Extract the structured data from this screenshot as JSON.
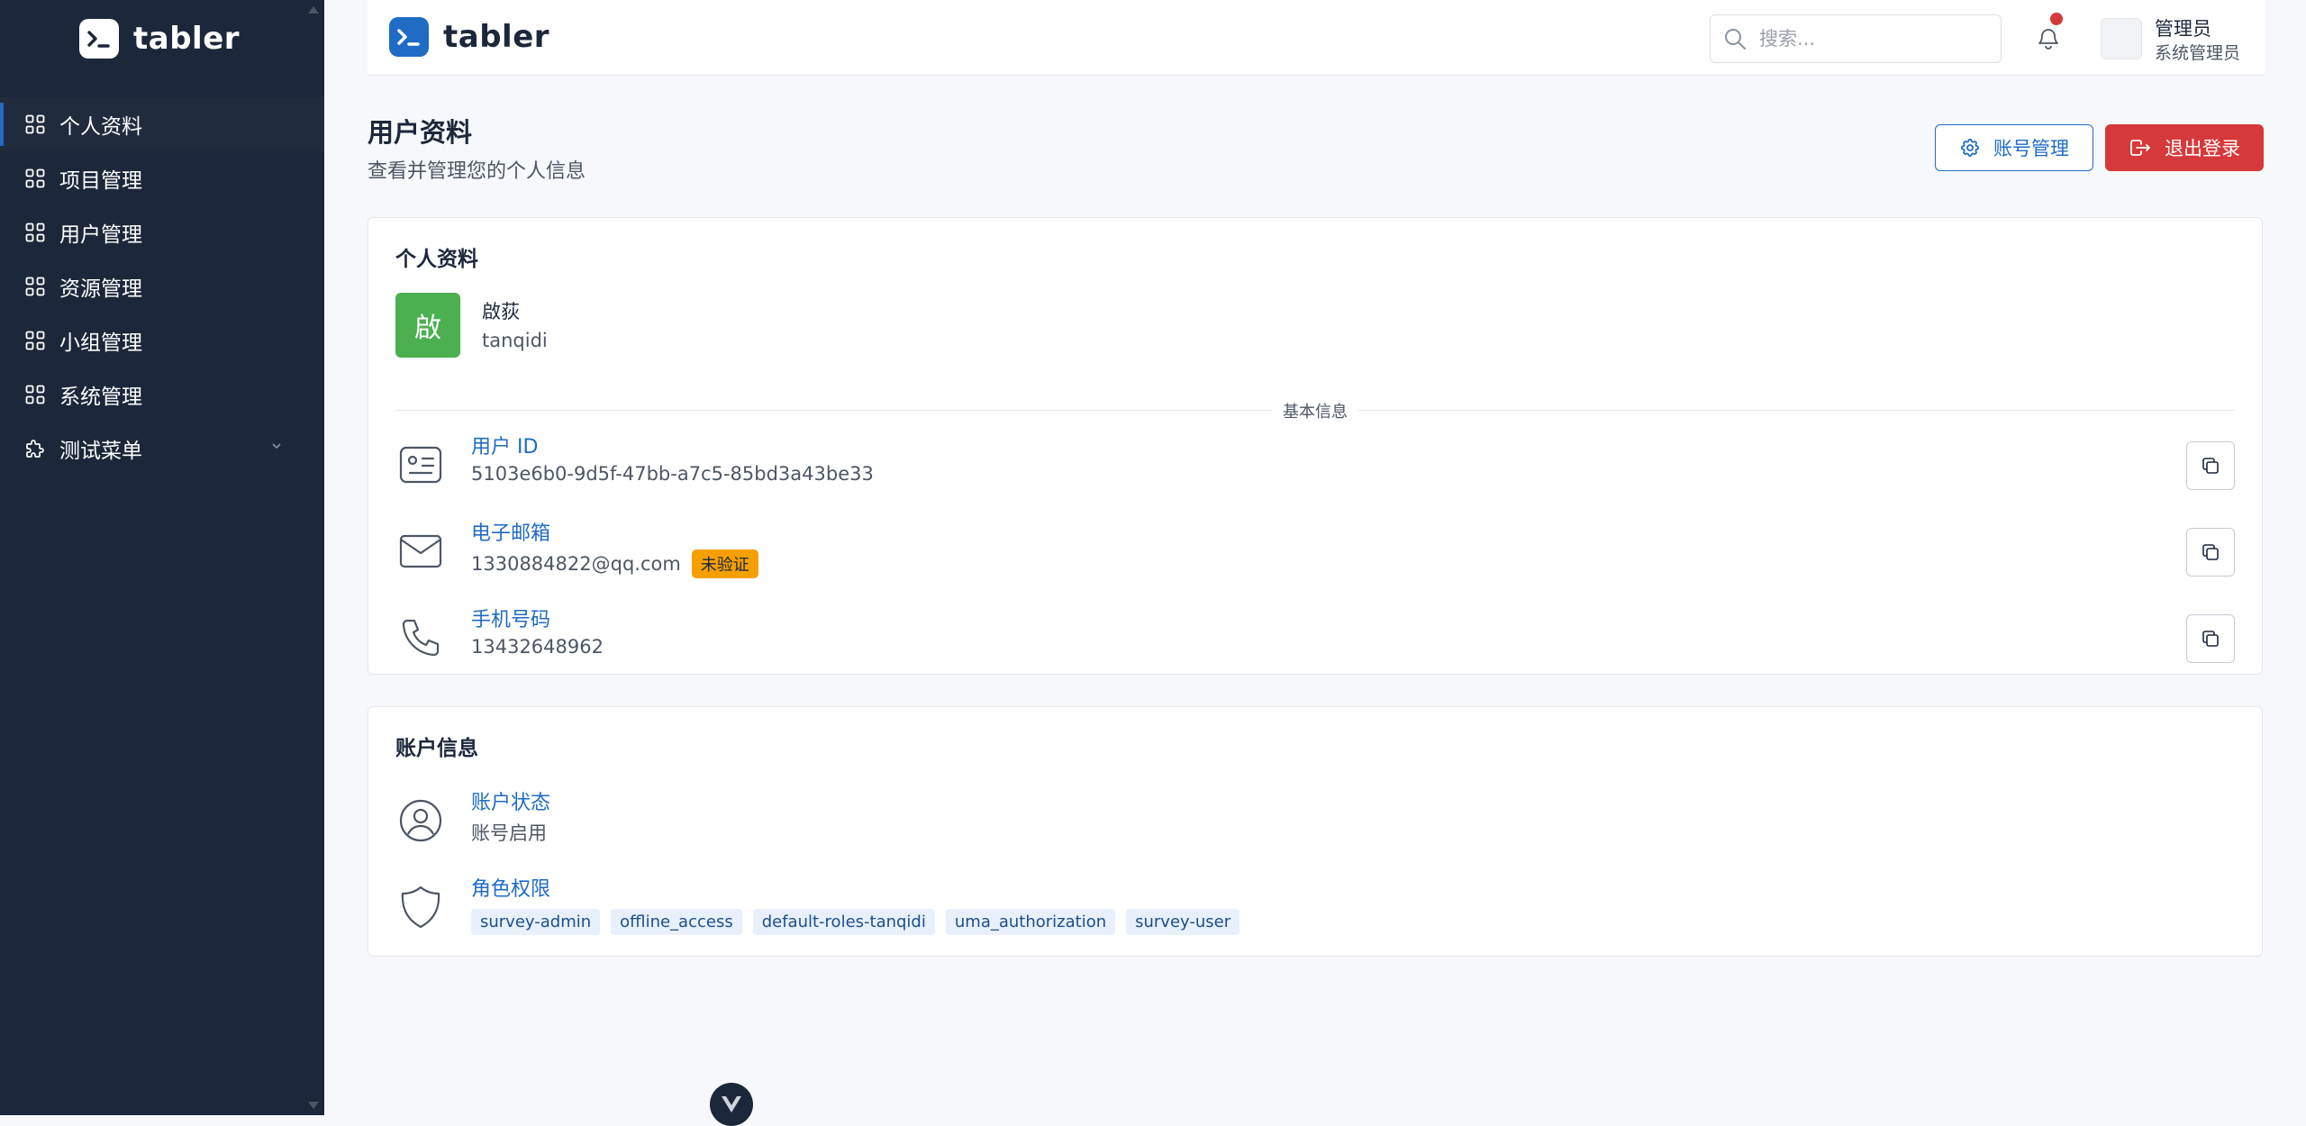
{
  "sidebar": {
    "brand": "tabler",
    "items": [
      {
        "label": "个人资料",
        "active": true
      },
      {
        "label": "项目管理"
      },
      {
        "label": "用户管理"
      },
      {
        "label": "资源管理"
      },
      {
        "label": "小组管理"
      },
      {
        "label": "系统管理"
      },
      {
        "label": "测试菜单",
        "icon": "puzzle-icon",
        "has_children": true
      }
    ]
  },
  "header": {
    "brand": "tabler",
    "search_placeholder": "搜索...",
    "user_name": "管理员",
    "user_role": "系统管理员"
  },
  "page": {
    "title": "用户资料",
    "subtitle": "查看并管理您的个人信息",
    "account_button": "账号管理",
    "logout_button": "退出登录"
  },
  "profile_card": {
    "title": "个人资料",
    "avatar_text": "啟",
    "display_name": "啟荻",
    "username": "tanqidi",
    "divider_label": "基本信息",
    "fields": {
      "user_id_label": "用户 ID",
      "user_id_value": "5103e6b0-9d5f-47bb-a7c5-85bd3a43be33",
      "email_label": "电子邮箱",
      "email_value": "1330884822@qq.com",
      "email_badge": "未验证",
      "phone_label": "手机号码",
      "phone_value": "13432648962"
    }
  },
  "account_card": {
    "title": "账户信息",
    "status_label": "账户状态",
    "status_value": "账号启用",
    "roles_label": "角色权限",
    "roles": [
      "survey-admin",
      "offline_access",
      "default-roles-tanqidi",
      "uma_authorization",
      "survey-user"
    ]
  },
  "colors": {
    "sidebar_bg": "#1d273b",
    "primary": "#206bc4",
    "danger": "#d63939",
    "warning": "#f59f00",
    "avatar_green": "#4caf50"
  }
}
